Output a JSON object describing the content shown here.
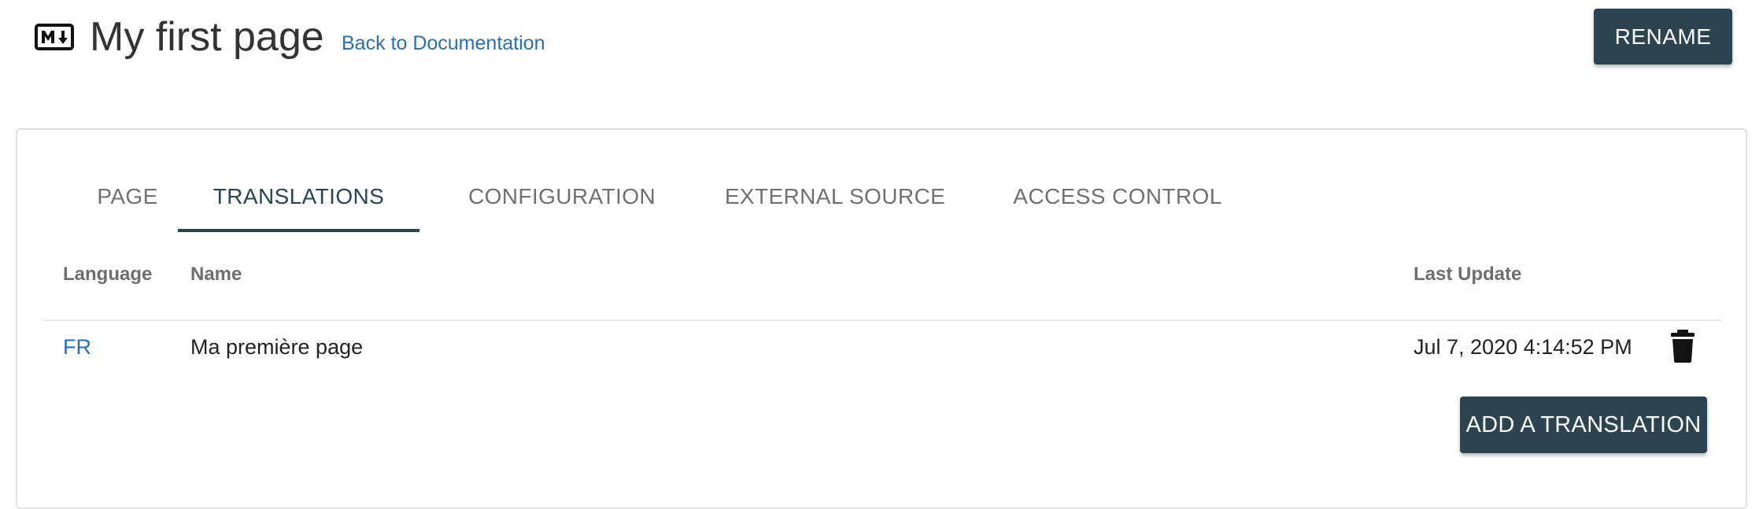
{
  "header": {
    "icon": "markdown-icon",
    "title": "My first page",
    "back_link": "Back to Documentation",
    "rename_label": "RENAME"
  },
  "tabs": [
    {
      "label": "PAGE",
      "active": false
    },
    {
      "label": "TRANSLATIONS",
      "active": true
    },
    {
      "label": "CONFIGURATION",
      "active": false
    },
    {
      "label": "EXTERNAL SOURCE",
      "active": false
    },
    {
      "label": "ACCESS CONTROL",
      "active": false
    }
  ],
  "table": {
    "columns": [
      "Language",
      "Name",
      "Last Update"
    ],
    "rows": [
      {
        "language": "FR",
        "name": "Ma première page",
        "last_update": "Jul 7, 2020 4:14:52 PM",
        "action_icon": "trash-icon"
      }
    ]
  },
  "add_translation_label": "ADD A TRANSLATION",
  "colors": {
    "primary": "#2b4450",
    "link": "#2d6fab",
    "tab_inactive": "#707070"
  }
}
